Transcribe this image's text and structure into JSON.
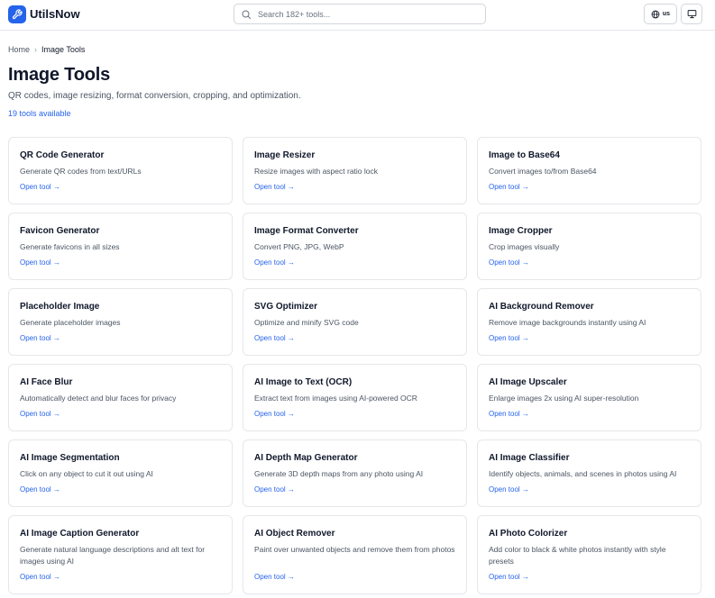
{
  "header": {
    "brand": "UtilsNow",
    "search_placeholder": "Search 182+ tools...",
    "language": "us",
    "icons": [
      "wrench-logo-icon",
      "search-icon",
      "globe-icon",
      "monitor-icon"
    ]
  },
  "breadcrumb": {
    "home": "Home",
    "separator": "›",
    "current": "Image Tools"
  },
  "page": {
    "title": "Image Tools",
    "description": "QR codes, image resizing, format conversion, cropping, and optimization.",
    "count": "19 tools available"
  },
  "open_label": "Open tool →",
  "colors": {
    "accent": "#2563eb",
    "border": "#e5e7eb",
    "text": "#0f172a",
    "muted": "#4b5563"
  },
  "tools": [
    {
      "title": "QR Code Generator",
      "desc": "Generate QR codes from text/URLs"
    },
    {
      "title": "Image Resizer",
      "desc": "Resize images with aspect ratio lock"
    },
    {
      "title": "Image to Base64",
      "desc": "Convert images to/from Base64"
    },
    {
      "title": "Favicon Generator",
      "desc": "Generate favicons in all sizes"
    },
    {
      "title": "Image Format Converter",
      "desc": "Convert PNG, JPG, WebP"
    },
    {
      "title": "Image Cropper",
      "desc": "Crop images visually"
    },
    {
      "title": "Placeholder Image",
      "desc": "Generate placeholder images"
    },
    {
      "title": "SVG Optimizer",
      "desc": "Optimize and minify SVG code"
    },
    {
      "title": "AI Background Remover",
      "desc": "Remove image backgrounds instantly using AI"
    },
    {
      "title": "AI Face Blur",
      "desc": "Automatically detect and blur faces for privacy"
    },
    {
      "title": "AI Image to Text (OCR)",
      "desc": "Extract text from images using AI-powered OCR"
    },
    {
      "title": "AI Image Upscaler",
      "desc": "Enlarge images 2x using AI super-resolution"
    },
    {
      "title": "AI Image Segmentation",
      "desc": "Click on any object to cut it out using AI"
    },
    {
      "title": "AI Depth Map Generator",
      "desc": "Generate 3D depth maps from any photo using AI"
    },
    {
      "title": "AI Image Classifier",
      "desc": "Identify objects, animals, and scenes in photos using AI"
    },
    {
      "title": "AI Image Caption Generator",
      "desc": "Generate natural language descriptions and alt text for images using AI"
    },
    {
      "title": "AI Object Remover",
      "desc": "Paint over unwanted objects and remove them from photos"
    },
    {
      "title": "AI Photo Colorizer",
      "desc": "Add color to black & white photos instantly with style presets"
    }
  ]
}
